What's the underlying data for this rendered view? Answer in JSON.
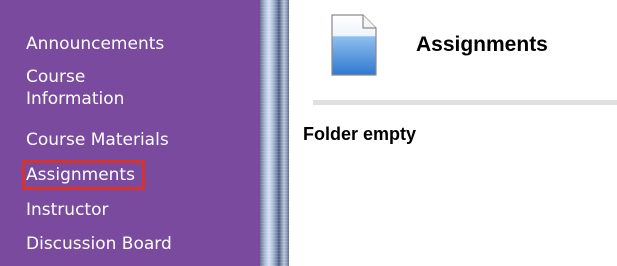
{
  "sidebar": {
    "items": [
      {
        "label_lines": [
          "Announcements"
        ]
      },
      {
        "label_lines": [
          "Course",
          "Information"
        ]
      },
      {
        "label_lines": [
          "Course Materials"
        ]
      },
      {
        "label_lines": [
          "Assignments"
        ]
      },
      {
        "label_lines": [
          "Instructor"
        ]
      },
      {
        "label_lines": [
          "Discussion Board"
        ]
      }
    ],
    "highlighted_item": "Assignments"
  },
  "main": {
    "title": "Assignments",
    "message": "Folder empty",
    "icon": "document-icon"
  },
  "colors": {
    "sidebar_bg": "#7a4a9e",
    "highlight_border": "#d9322b",
    "icon_blue": "#3a7fd0"
  }
}
